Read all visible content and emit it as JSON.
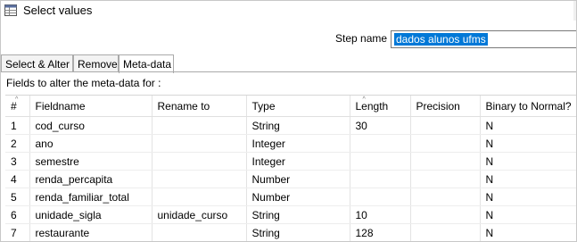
{
  "window": {
    "title": "Select values",
    "icon": "table-grid-icon"
  },
  "step": {
    "label": "Step name",
    "value": "dados alunos ufms"
  },
  "tabs": [
    {
      "label": "Select & Alter"
    },
    {
      "label": "Remove"
    },
    {
      "label": "Meta-data"
    }
  ],
  "fields_label": "Fields to alter the meta-data for :",
  "table": {
    "columns": [
      "#",
      "Fieldname",
      "Rename to",
      "Type",
      "Length",
      "Precision",
      "Binary to Normal?"
    ],
    "rows": [
      [
        "1",
        "cod_curso",
        "",
        "String",
        "30",
        "",
        "N"
      ],
      [
        "2",
        "ano",
        "",
        "Integer",
        "",
        "",
        "N"
      ],
      [
        "3",
        "semestre",
        "",
        "Integer",
        "",
        "",
        "N"
      ],
      [
        "4",
        "renda_percapita",
        "",
        "Number",
        "",
        "",
        "N"
      ],
      [
        "5",
        "renda_familiar_total",
        "",
        "Number",
        "",
        "",
        "N"
      ],
      [
        "6",
        "unidade_sigla",
        "unidade_curso",
        "String",
        "10",
        "",
        "N"
      ],
      [
        "7",
        "restaurante",
        "",
        "String",
        "128",
        "",
        "N"
      ]
    ]
  }
}
